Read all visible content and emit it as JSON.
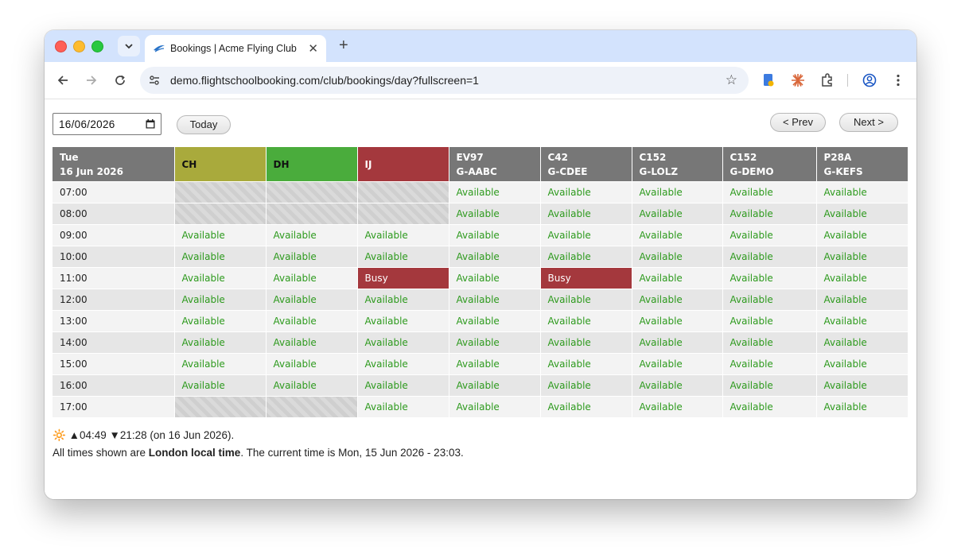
{
  "browser": {
    "tab_title": "Bookings | Acme Flying Club",
    "url": "demo.flightschoolbooking.com/club/bookings/day?fullscreen=1",
    "icons": [
      "tab-search-icon",
      "favicon-plane-icon",
      "close-icon",
      "new-tab-icon",
      "back-icon",
      "forward-icon",
      "reload-icon",
      "site-settings-icon",
      "star-icon",
      "extension-doc-icon",
      "extension-sunburst-icon",
      "puzzle-icon",
      "profile-icon",
      "more-icon"
    ]
  },
  "controls": {
    "date_value": "16/06/2026",
    "today_label": "Today",
    "prev_label": "< Prev",
    "next_label": "Next >"
  },
  "colors": {
    "ch": "#a9aa3c",
    "dh": "#4aac3c",
    "ij": "#a4383d",
    "aircraft": "#777777",
    "available": "#2d9a1d",
    "busy": "#a4383d"
  },
  "grid": {
    "header_day": "Tue",
    "header_date": "16 Jun 2026",
    "columns": [
      {
        "line1": "CH",
        "line2": ""
      },
      {
        "line1": "DH",
        "line2": ""
      },
      {
        "line1": "IJ",
        "line2": ""
      },
      {
        "line1": "EV97",
        "line2": "G-AABC"
      },
      {
        "line1": "C42",
        "line2": "G-CDEE"
      },
      {
        "line1": "C152",
        "line2": "G-LOLZ"
      },
      {
        "line1": "C152",
        "line2": "G-DEMO"
      },
      {
        "line1": "P28A",
        "line2": "G-KEFS"
      }
    ],
    "rows": [
      {
        "time": "07:00",
        "cells": [
          "",
          "",
          "",
          "Available",
          "Available",
          "Available",
          "Available",
          "Available"
        ]
      },
      {
        "time": "08:00",
        "cells": [
          "",
          "",
          "",
          "Available",
          "Available",
          "Available",
          "Available",
          "Available"
        ]
      },
      {
        "time": "09:00",
        "cells": [
          "Available",
          "Available",
          "Available",
          "Available",
          "Available",
          "Available",
          "Available",
          "Available"
        ]
      },
      {
        "time": "10:00",
        "cells": [
          "Available",
          "Available",
          "Available",
          "Available",
          "Available",
          "Available",
          "Available",
          "Available"
        ]
      },
      {
        "time": "11:00",
        "cells": [
          "Available",
          "Available",
          "Busy",
          "Available",
          "Busy",
          "Available",
          "Available",
          "Available"
        ]
      },
      {
        "time": "12:00",
        "cells": [
          "Available",
          "Available",
          "Available",
          "Available",
          "Available",
          "Available",
          "Available",
          "Available"
        ]
      },
      {
        "time": "13:00",
        "cells": [
          "Available",
          "Available",
          "Available",
          "Available",
          "Available",
          "Available",
          "Available",
          "Available"
        ]
      },
      {
        "time": "14:00",
        "cells": [
          "Available",
          "Available",
          "Available",
          "Available",
          "Available",
          "Available",
          "Available",
          "Available"
        ]
      },
      {
        "time": "15:00",
        "cells": [
          "Available",
          "Available",
          "Available",
          "Available",
          "Available",
          "Available",
          "Available",
          "Available"
        ]
      },
      {
        "time": "16:00",
        "cells": [
          "Available",
          "Available",
          "Available",
          "Available",
          "Available",
          "Available",
          "Available",
          "Available"
        ]
      },
      {
        "time": "17:00",
        "cells": [
          "",
          "",
          "Available",
          "Available",
          "Available",
          "Available",
          "Available",
          "Available"
        ]
      }
    ]
  },
  "footer": {
    "sun_icon": "sun-icon",
    "sun_text": "▲04:49 ▼21:28 (on 16 Jun 2026).",
    "tz_prefix": "All times shown are ",
    "tz_bold": "London local time",
    "tz_suffix": ". The current time is Mon, 15 Jun 2026 - 23:03."
  }
}
